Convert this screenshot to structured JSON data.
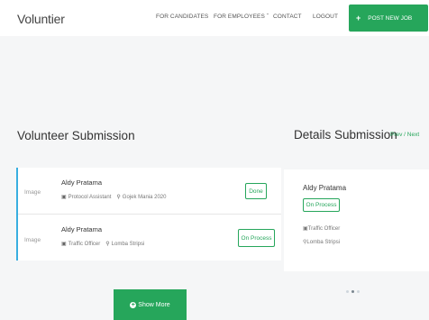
{
  "header": {
    "logo": "Voluntier",
    "nav": {
      "for_candidates": "FOR CANDIDATES",
      "for_employees": "FOR EMPLOYEES ˇ",
      "contact": "CONTACT",
      "logout": "LOGOUT"
    },
    "post_button": "POST NEW JOB",
    "post_icon": "plus-icon"
  },
  "volunteer_section": {
    "title": "Volunteer Submission",
    "items": [
      {
        "image_label": "Image",
        "name": "Aldy Pratama",
        "role": "Protocol Assistant",
        "event": "Gojek Mania 2020",
        "status": "Done"
      },
      {
        "image_label": "Image",
        "name": "Aldy Pratama",
        "role": "Traffic Officer",
        "event": "Lomba Stripsi",
        "status": "On Process"
      }
    ],
    "show_more": "Show More"
  },
  "details_section": {
    "title": "Details Submission",
    "pager": "Prev / Next",
    "name": "Aldy Pratama",
    "status": "On Process",
    "role": "Traffic Officer",
    "event": "Lomba Stripsi"
  },
  "colors": {
    "accent": "#26a65b",
    "highlight_border": "#38aee0"
  }
}
